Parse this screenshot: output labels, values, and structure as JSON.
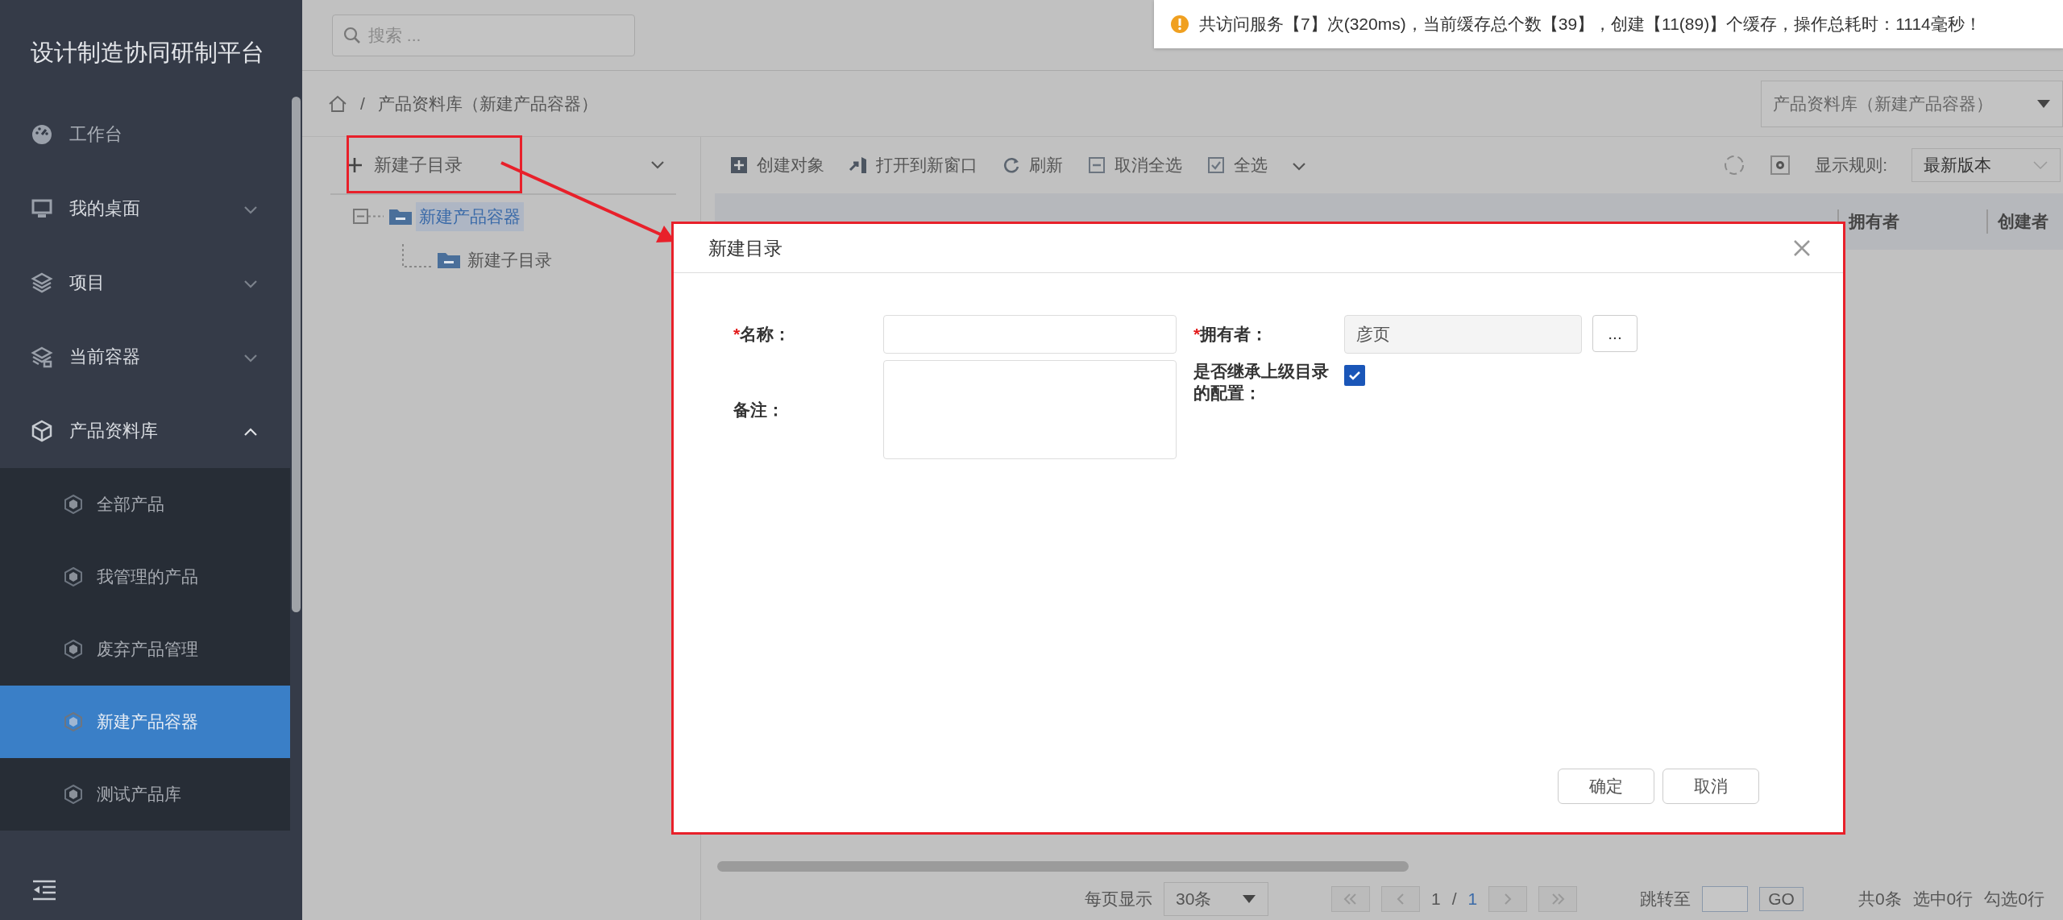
{
  "sidebar": {
    "title": "设计制造协同研制平台",
    "items": [
      {
        "label": "工作台",
        "has_children": false
      },
      {
        "label": "我的桌面",
        "has_children": true,
        "expanded": false
      },
      {
        "label": "项目",
        "has_children": true,
        "expanded": false
      },
      {
        "label": "当前容器",
        "has_children": true,
        "expanded": false
      },
      {
        "label": "产品资料库",
        "has_children": true,
        "expanded": true,
        "children": [
          {
            "label": "全部产品",
            "selected": false
          },
          {
            "label": "我管理的产品",
            "selected": false
          },
          {
            "label": "废弃产品管理",
            "selected": false
          },
          {
            "label": "新建产品容器",
            "selected": true
          },
          {
            "label": "测试产品库",
            "selected": false
          }
        ]
      }
    ]
  },
  "search": {
    "placeholder": "搜索 ..."
  },
  "notification": {
    "text": "共访问服务【7】次(320ms)，当前缓存总个数【39】，创建【11(89)】个缓存，操作总耗时：1114毫秒！"
  },
  "breadcrumb": {
    "separator": "/",
    "current": "产品资料库（新建产品容器）"
  },
  "library_select": {
    "value": "产品资料库（新建产品容器）"
  },
  "tree_panel": {
    "new_button": "新建子目录",
    "tree": [
      {
        "label": "新建产品容器",
        "selected": true,
        "expanded": true,
        "children": [
          {
            "label": "新建子目录",
            "selected": false
          }
        ]
      }
    ]
  },
  "toolbar": {
    "actions": [
      "创建对象",
      "打开到新窗口",
      "刷新",
      "取消全选",
      "全选"
    ],
    "display_rule_label": "显示规则:",
    "display_rule_value": "最新版本"
  },
  "table": {
    "columns": [
      "拥有者",
      "创建者"
    ]
  },
  "pagination": {
    "page_size_label": "每页显示",
    "page_size": "30条",
    "page": "1",
    "separator": "/",
    "total_pages": "1",
    "jump_label": "跳转至",
    "go": "GO",
    "summary": [
      "共0条",
      "选中0行",
      "勾选0行"
    ]
  },
  "dialog": {
    "title": "新建目录",
    "left_fields": [
      {
        "kind": "text",
        "required_mark": "*",
        "label": "名称："
      },
      {
        "kind": "textarea",
        "label": "备注："
      }
    ],
    "right_fields": [
      {
        "kind": "picker",
        "required_mark": "*",
        "label": "拥有者：",
        "value": "彦页",
        "button": "..."
      },
      {
        "kind": "checkbox",
        "label": "是否继承上级目录的配置：",
        "checked": true
      }
    ],
    "buttons": [
      "确定",
      "取消"
    ]
  }
}
